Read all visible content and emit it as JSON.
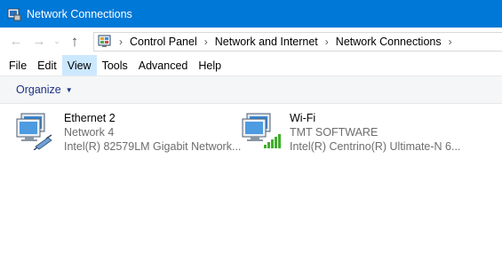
{
  "window": {
    "title": "Network Connections"
  },
  "nav": {
    "back_icon": "arrow-left-icon",
    "forward_icon": "arrow-right-icon",
    "recent_icon": "chevron-down-icon",
    "up_icon": "arrow-up-icon"
  },
  "breadcrumb": [
    "Control Panel",
    "Network and Internet",
    "Network Connections"
  ],
  "menu": [
    "File",
    "Edit",
    "View",
    "Tools",
    "Advanced",
    "Help"
  ],
  "menu_active": "View",
  "toolbar": {
    "organize_label": "Organize"
  },
  "connections": [
    {
      "name": "Ethernet 2",
      "status": "Network  4",
      "device": "Intel(R) 82579LM Gigabit Network...",
      "icon": "ethernet-adapter-icon"
    },
    {
      "name": "Wi-Fi",
      "status": "TMT SOFTWARE",
      "device": "Intel(R) Centrino(R) Ultimate-N 6...",
      "icon": "wifi-adapter-icon"
    }
  ],
  "colors": {
    "titlebar": "#0078d7",
    "menu_active": "#cce8ff",
    "cmdbar": "#f5f6f7",
    "organize": "#1e3287",
    "signal": "#3fae2a"
  }
}
